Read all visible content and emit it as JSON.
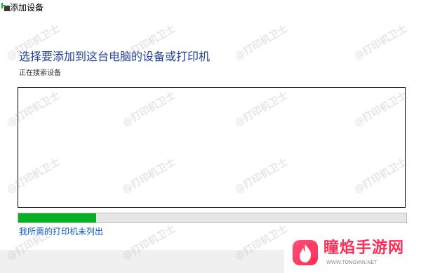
{
  "window": {
    "title": "添加设备"
  },
  "main": {
    "heading": "选择要添加到这台电脑的设备或打印机",
    "status_text": "正在搜索设备",
    "progress_percent": 20,
    "missing_printer_link": "我所需的打印机未列出"
  },
  "watermark": {
    "text": "@打印机卫士"
  },
  "logo": {
    "name": "瞳焰手游网",
    "url": "WWW.TONGYAN.NET"
  },
  "icons": {
    "title_icon": "add-device-plus-icon",
    "logo_icon": "flame-logo-icon"
  },
  "colors": {
    "heading": "#1f3f9a",
    "progress": "#06b025",
    "link": "#0b5bc5"
  }
}
